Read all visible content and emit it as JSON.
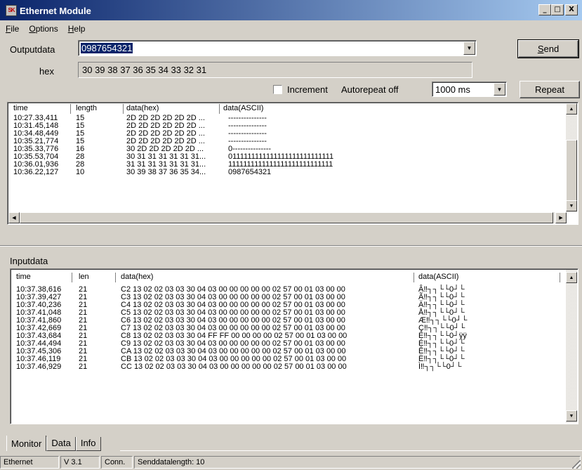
{
  "window": {
    "title": "Ethernet Module",
    "icon_label": "SK",
    "minimize": "_",
    "maximize": "□",
    "close": "X"
  },
  "menu": [
    {
      "accel": "F",
      "rest": "ile"
    },
    {
      "accel": "O",
      "rest": "ptions"
    },
    {
      "accel": "H",
      "rest": "elp"
    }
  ],
  "output": {
    "label": "Outputdata",
    "value": "0987654321",
    "hex_label": "hex",
    "hex_value": "30 39 38 37 36 35 34 33 32 31",
    "send_accel": "S",
    "send_rest": "end",
    "increment_label": "Increment",
    "increment_checked": false,
    "autorepeat_label": "Autorepeat off",
    "interval_value": "1000 ms",
    "repeat_label": "Repeat"
  },
  "output_log": {
    "columns": [
      "time",
      "length",
      "data(hex)",
      "data(ASCII)"
    ],
    "rows": [
      [
        "10:27.33,411",
        "15",
        "2D 2D 2D 2D 2D 2D ...",
        "---------------"
      ],
      [
        "10:31.45,148",
        "15",
        "2D 2D 2D 2D 2D 2D ...",
        "---------------"
      ],
      [
        "10:34.48,449",
        "15",
        "2D 2D 2D 2D 2D 2D ...",
        "---------------"
      ],
      [
        "10:35.21,774",
        "15",
        "2D 2D 2D 2D 2D 2D ...",
        "---------------"
      ],
      [
        "10:35.33,776",
        "16",
        "30 2D 2D 2D 2D 2D ...",
        "0---------------"
      ],
      [
        "10:35.53,704",
        "28",
        "30 31 31 31 31 31 31...",
        "0111111111111111111111111111"
      ],
      [
        "10:36.01,936",
        "28",
        "31 31 31 31 31 31 31...",
        "1111111111111111111111111111"
      ],
      [
        "10:36.22,127",
        "10",
        "30 39 38 37 36 35 34...",
        "0987654321"
      ]
    ]
  },
  "input": {
    "section_label": "Inputdata",
    "columns": [
      "time",
      "len",
      "data(hex)",
      "data(ASCII)"
    ],
    "rows": [
      [
        "10:37.38,616",
        "21",
        "C2 13 02 02 03 03 30 04 03 00 00 00 00 00 02 57 00 01 03 00 00",
        "Â‼┐┐└└0┘└"
      ],
      [
        "10:37.39,427",
        "21",
        "C3 13 02 02 03 03 30 04 03 00 00 00 00 00 02 57 00 01 03 00 00",
        "Ã‼┐┐└└0┘└"
      ],
      [
        "10:37.40,236",
        "21",
        "C4 13 02 02 03 03 30 04 03 00 00 00 00 00 02 57 00 01 03 00 00",
        "Ä‼┐┐└└0┘└"
      ],
      [
        "10:37.41,048",
        "21",
        "C5 13 02 02 03 03 30 04 03 00 00 00 00 00 02 57 00 01 03 00 00",
        "Å‼┐┐└└0┘└"
      ],
      [
        "10:37.41,860",
        "21",
        "C6 13 02 02 03 03 30 04 03 00 00 00 00 00 02 57 00 01 03 00 00",
        "Æ‼┐┐└└0┘└"
      ],
      [
        "10:37.42,669",
        "21",
        "C7 13 02 02 03 03 30 04 03 00 00 00 00 00 02 57 00 01 03 00 00",
        "Ç‼┐┐└└0┘└"
      ],
      [
        "10:37.43,684",
        "21",
        "C8 13 02 02 03 03 30 04 FF FF 00 00 00 00 02 57 00 01 03 00 00",
        "È‼┐┐└└0┘ÿÿ"
      ],
      [
        "10:37.44,494",
        "21",
        "C9 13 02 02 03 03 30 04 03 00 00 00 00 00 02 57 00 01 03 00 00",
        "É‼┐┐└└0┘└"
      ],
      [
        "10:37.45,306",
        "21",
        "CA 13 02 02 03 03 30 04 03 00 00 00 00 00 02 57 00 01 03 00 00",
        "Ê‼┐┐└└0┘└"
      ],
      [
        "10:37.46,119",
        "21",
        "CB 13 02 02 03 03 30 04 03 00 00 00 00 00 02 57 00 01 03 00 00",
        "Ë‼┐┐└└0┘└"
      ],
      [
        "10:37.46,929",
        "21",
        "CC 13 02 02 03 03 30 04 03 00 00 00 00 00 02 57 00 01 03 00 00",
        "Ì‼┐┐└└0┘└"
      ]
    ]
  },
  "tabs": [
    "Monitor",
    "Data",
    "Info"
  ],
  "active_tab": "Monitor",
  "status": [
    "Ethernet",
    "V 3.1",
    "Conn.",
    "Senddatalength: 10"
  ],
  "colors": {
    "title_start": "#0a246a",
    "title_end": "#a6caf0",
    "face": "#d4d0c8",
    "selection": "#0a246a"
  },
  "icons": {
    "dropdown": "chevron-down-icon",
    "scroll_up": "scroll-up-icon",
    "scroll_down": "scroll-down-icon",
    "scroll_left": "scroll-left-icon",
    "scroll_right": "scroll-right-icon",
    "resize_grip": "resize-grip-icon"
  }
}
